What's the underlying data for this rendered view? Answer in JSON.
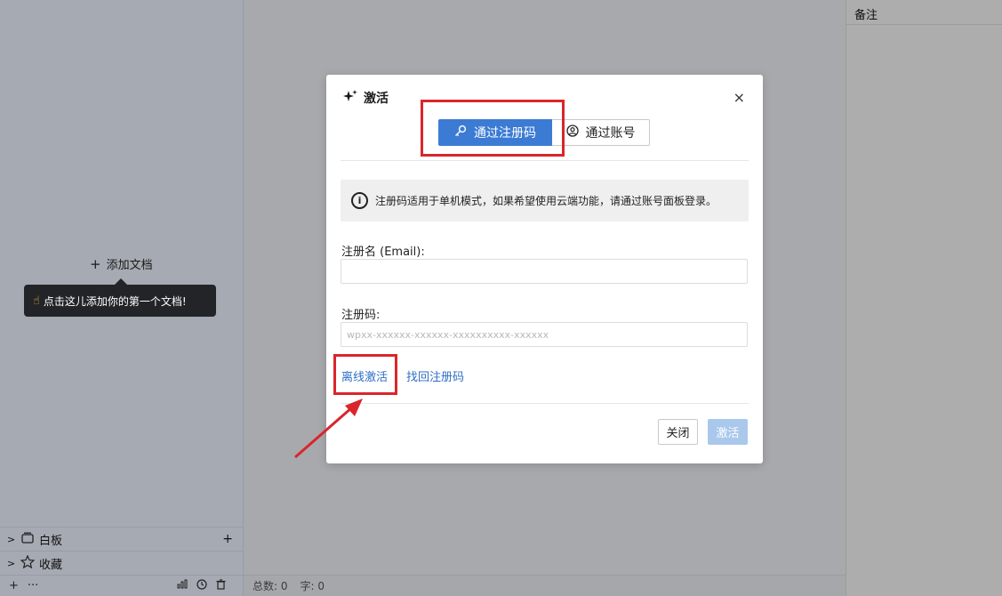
{
  "sidebar": {
    "add_doc_label": "添加文档",
    "tooltip_text": "点击这儿添加你的第一个文档!",
    "items": [
      {
        "label": "白板",
        "icon": "whiteboard-icon"
      },
      {
        "label": "收藏",
        "icon": "star-icon"
      }
    ],
    "footer_more": "···"
  },
  "notes": {
    "title": "备注"
  },
  "statusbar": {
    "total": "总数: 0",
    "chars": "字: 0"
  },
  "modal": {
    "title": "激活",
    "close_symbol": "×",
    "tabs": [
      {
        "label": "通过注册码",
        "icon": "key-icon",
        "active": true
      },
      {
        "label": "通过账号",
        "icon": "user-circle-icon",
        "active": false
      }
    ],
    "info": "注册码适用于单机模式，如果希望使用云端功能，请通过账号面板登录。",
    "email_label": "注册名 (Email):",
    "email_value": "",
    "code_label": "注册码:",
    "code_placeholder": "wpxx-xxxxxx-xxxxxx-xxxxxxxxxx-xxxxxx",
    "offline_link": "离线激活",
    "recover_link": "找回注册码",
    "close_button": "关闭",
    "activate_button": "激活"
  },
  "colors": {
    "accent": "#3c7bd4",
    "annotation_red": "#d9262b",
    "link": "#2f6fc4"
  }
}
